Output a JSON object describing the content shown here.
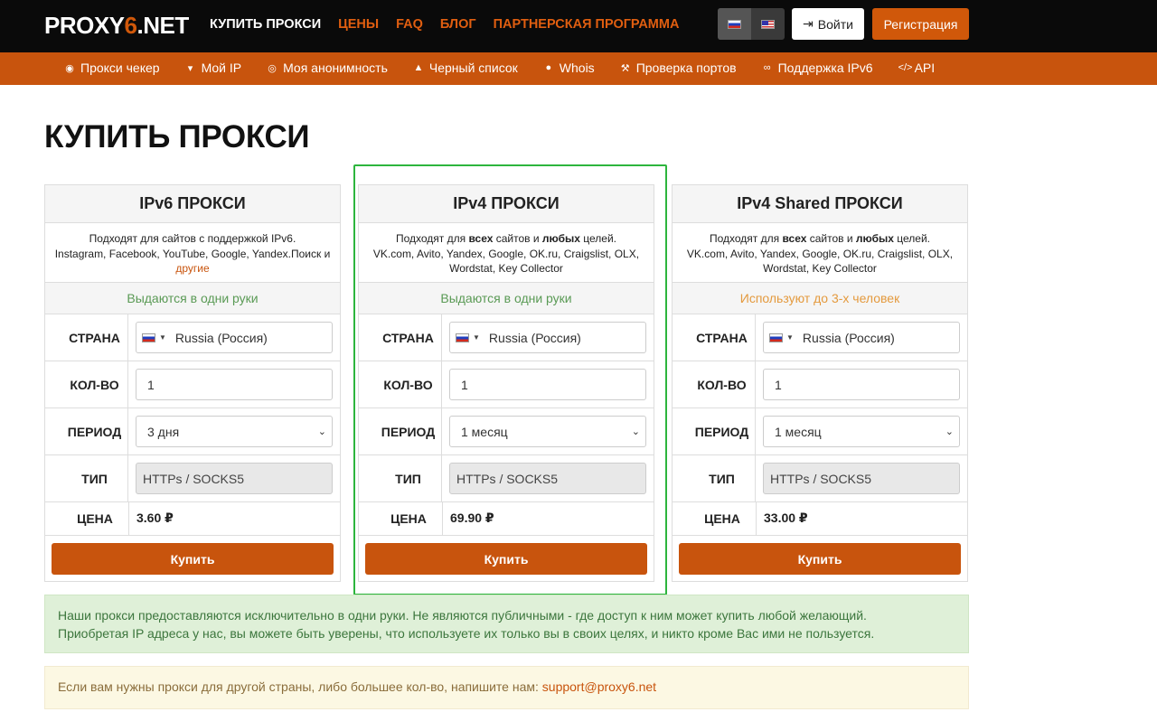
{
  "header": {
    "logo_prefix": "PROXY",
    "logo_six": "6",
    "logo_suffix": ".NET",
    "nav": [
      "КУПИТЬ ПРОКСИ",
      "ЦЕНЫ",
      "FAQ",
      "БЛОГ",
      "ПАРТНЕРСКАЯ ПРОГРАММА"
    ],
    "login_label": "Войти",
    "register_label": "Регистрация"
  },
  "subnav": [
    "Прокси чекер",
    "Мой IP",
    "Моя анонимность",
    "Черный список",
    "Whois",
    "Проверка портов",
    "Поддержка IPv6",
    "API"
  ],
  "page_title": "КУПИТЬ ПРОКСИ",
  "labels": {
    "country": "СТРАНА",
    "qty": "КОЛ-ВО",
    "period": "ПЕРИОД",
    "type": "ТИП",
    "price": "ЦЕНА",
    "buy": "Купить"
  },
  "cards": [
    {
      "title": "IPv6 ПРОКСИ",
      "desc_line1": "Подходят для сайтов с поддержкой IPv6.",
      "desc_line2": "Instagram, Facebook, YouTube, Google, Yandex.Поиск и",
      "desc_link": "другие",
      "note": "Выдаются в одни руки",
      "country": "Russia (Россия)",
      "qty": "1",
      "period": "3 дня",
      "type": "HTTPs / SOCKS5",
      "price": "3.60 ₽"
    },
    {
      "title": "IPv4 ПРОКСИ",
      "desc_pre": "Подходят для ",
      "desc_b1": "всех",
      "desc_mid": " сайтов и ",
      "desc_b2": "любых",
      "desc_post": " целей.",
      "desc_line2": "VK.com, Avito, Yandex, Google, OK.ru, Craigslist, OLX,",
      "desc_line3": "Wordstat, Key Collector",
      "note": "Выдаются в одни руки",
      "country": "Russia (Россия)",
      "qty": "1",
      "period": "1 месяц",
      "type": "HTTPs / SOCKS5",
      "price": "69.90 ₽"
    },
    {
      "title": "IPv4 Shared ПРОКСИ",
      "desc_pre": "Подходят для ",
      "desc_b1": "всех",
      "desc_mid": " сайтов и ",
      "desc_b2": "любых",
      "desc_post": " целей.",
      "desc_line2": "VK.com, Avito, Yandex, Google, OK.ru, Craigslist, OLX,",
      "desc_line3": "Wordstat, Key Collector",
      "note": "Используют до 3-х человек",
      "country": "Russia (Россия)",
      "qty": "1",
      "period": "1 месяц",
      "type": "HTTPs / SOCKS5",
      "price": "33.00 ₽"
    }
  ],
  "alert_green": {
    "line1": "Наши прокси предоставляются исключительно в одни руки. Не являются публичными - где доступ к ним может купить любой желающий.",
    "line2": "Приобретая IP адреса у нас, вы можете быть уверены, что используете их только вы в своих целях, и никто кроме Вас ими не пользуется."
  },
  "alert_yellow": {
    "text": "Если вам нужны прокси для другой страны, либо большее кол-во, напишите нам: ",
    "email": "support@proxy6.net"
  },
  "colors": {
    "brand": "#c8540d",
    "highlight": "#2db53d"
  }
}
